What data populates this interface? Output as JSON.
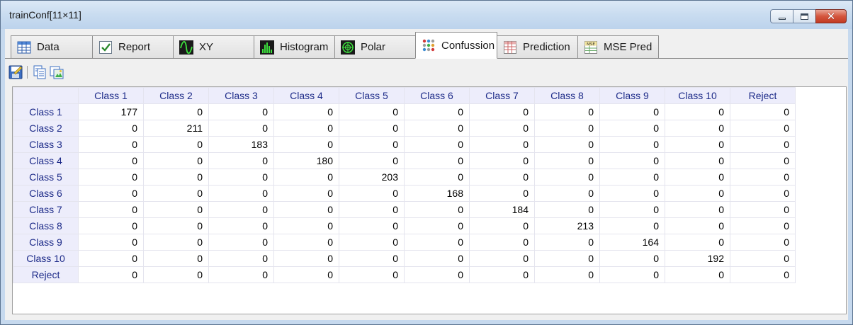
{
  "window": {
    "title": "trainConf[11×11]",
    "minimize_icon": "minimize-icon",
    "maximize_icon": "maximize-icon",
    "close_icon": "close-icon",
    "close_glyph": "✕"
  },
  "tabs": [
    {
      "label": "Data",
      "icon": "data-grid-icon",
      "active": false
    },
    {
      "label": "Report",
      "icon": "report-check-icon",
      "active": false
    },
    {
      "label": "XY",
      "icon": "xy-plot-icon",
      "active": false
    },
    {
      "label": "Histogram",
      "icon": "histogram-icon",
      "active": false
    },
    {
      "label": "Polar",
      "icon": "polar-plot-icon",
      "active": false
    },
    {
      "label": "Confussion",
      "icon": "confusion-matrix-icon",
      "active": true
    },
    {
      "label": "Prediction",
      "icon": "prediction-table-icon",
      "active": false
    },
    {
      "label": "MSE Pred",
      "icon": "mse-pred-icon",
      "active": false
    }
  ],
  "toolbar": {
    "buttons": [
      "save-icon",
      "copy-icon",
      "export-image-icon"
    ]
  },
  "colors": {
    "header_bg": "#ededfb",
    "header_text": "#1c2a88",
    "grid_line": "#e4e4ee",
    "window_frame": "#c6d9ee",
    "close_button": "#c9452d"
  },
  "matrix": {
    "columns": [
      "Class 1",
      "Class 2",
      "Class 3",
      "Class 4",
      "Class 5",
      "Class 6",
      "Class 7",
      "Class 8",
      "Class 9",
      "Class 10",
      "Reject"
    ],
    "rows": [
      {
        "label": "Class 1",
        "values": [
          "177",
          "0",
          "0",
          "0",
          "0",
          "0",
          "0",
          "0",
          "0",
          "0",
          "0"
        ]
      },
      {
        "label": "Class 2",
        "values": [
          "0",
          "211",
          "0",
          "0",
          "0",
          "0",
          "0",
          "0",
          "0",
          "0",
          "0"
        ]
      },
      {
        "label": "Class 3",
        "values": [
          "0",
          "0",
          "183",
          "0",
          "0",
          "0",
          "0",
          "0",
          "0",
          "0",
          "0"
        ]
      },
      {
        "label": "Class 4",
        "values": [
          "0",
          "0",
          "0",
          "180",
          "0",
          "0",
          "0",
          "0",
          "0",
          "0",
          "0"
        ]
      },
      {
        "label": "Class 5",
        "values": [
          "0",
          "0",
          "0",
          "0",
          "203",
          "0",
          "0",
          "0",
          "0",
          "0",
          "0"
        ]
      },
      {
        "label": "Class 6",
        "values": [
          "0",
          "0",
          "0",
          "0",
          "0",
          "168",
          "0",
          "0",
          "0",
          "0",
          "0"
        ]
      },
      {
        "label": "Class 7",
        "values": [
          "0",
          "0",
          "0",
          "0",
          "0",
          "0",
          "184",
          "0",
          "0",
          "0",
          "0"
        ]
      },
      {
        "label": "Class 8",
        "values": [
          "0",
          "0",
          "0",
          "0",
          "0",
          "0",
          "0",
          "213",
          "0",
          "0",
          "0"
        ]
      },
      {
        "label": "Class 9",
        "values": [
          "0",
          "0",
          "0",
          "0",
          "0",
          "0",
          "0",
          "0",
          "164",
          "0",
          "0"
        ]
      },
      {
        "label": "Class 10",
        "values": [
          "0",
          "0",
          "0",
          "0",
          "0",
          "0",
          "0",
          "0",
          "0",
          "192",
          "0"
        ]
      },
      {
        "label": "Reject",
        "values": [
          "0",
          "0",
          "0",
          "0",
          "0",
          "0",
          "0",
          "0",
          "0",
          "0",
          "0"
        ]
      }
    ]
  }
}
